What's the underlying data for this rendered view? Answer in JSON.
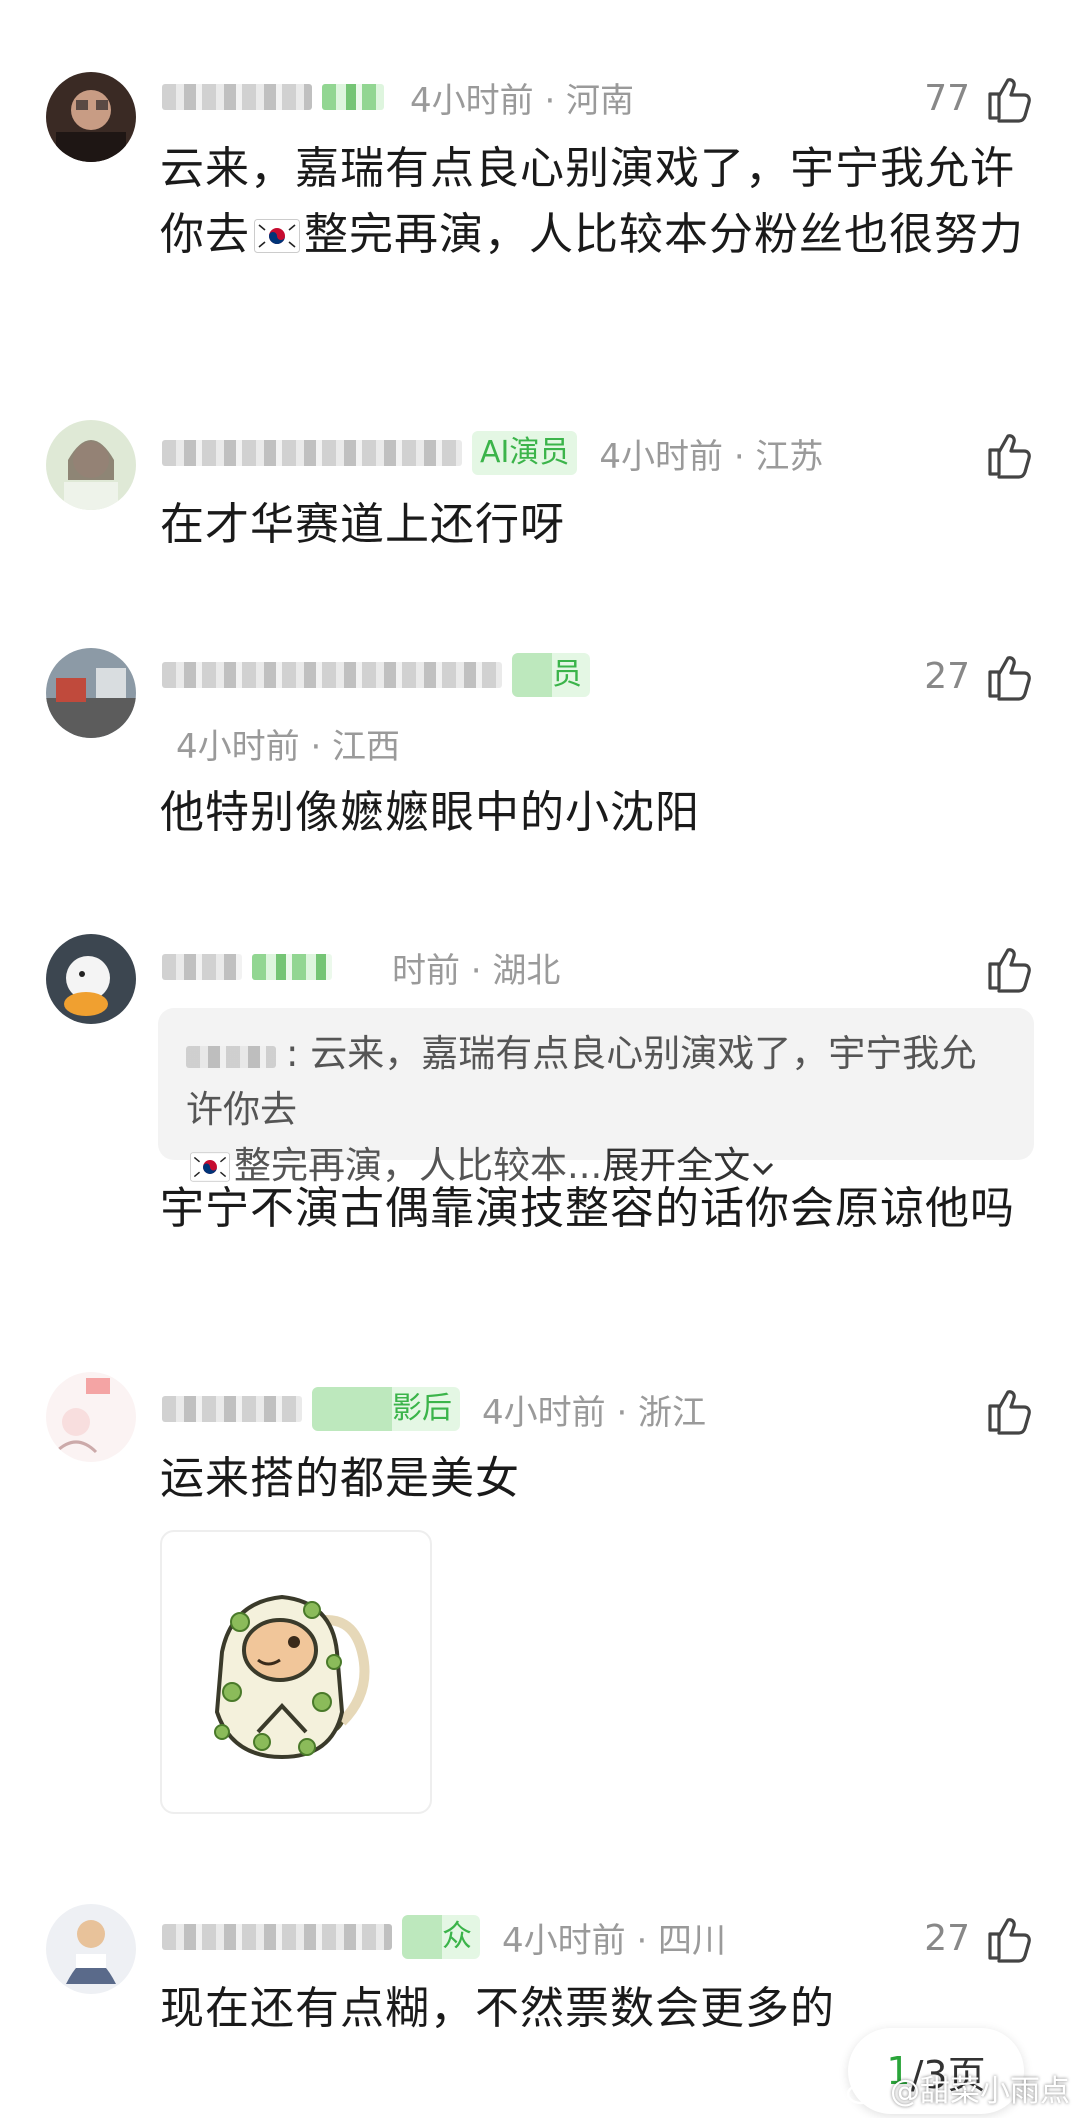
{
  "comments": [
    {
      "badge": "",
      "meta": "4小时前 · 河南",
      "likes": "77",
      "text_a": "云来，嘉瑞有点良心别演戏了，宇宁我允许你去",
      "text_b": "整完再演，人比较本分粉丝也很努力"
    },
    {
      "badge": "AI演员",
      "meta": "4小时前 · 江苏",
      "likes": "",
      "text": "在才华赛道上还行呀"
    },
    {
      "badge": "员",
      "meta": "4小时前 · 江西",
      "likes": "27",
      "text": "他特别像嬷嬷眼中的小沈阳"
    },
    {
      "badge": "",
      "meta": "时前 · 湖北",
      "likes": "",
      "quote_a": ": 云来，嘉瑞有点良心别演戏了，宇宁我允许你去",
      "quote_b": "整完再演，人比较本...",
      "quote_expand": "展开全文",
      "text": "宇宁不演古偶靠演技整容的话你会原谅他吗"
    },
    {
      "badge": "影后",
      "meta": "4小时前 · 浙江",
      "likes": "",
      "text": "运来搭的都是美女"
    },
    {
      "badge": "众",
      "meta": "4小时前 · 四川",
      "likes": "27",
      "text": "现在还有点糊，不然票数会更多的"
    }
  ],
  "pagination": {
    "current": "1",
    "rest": "/3页"
  },
  "watermark": "@甜菜小雨点",
  "icons": {
    "like": "thumbs-up-icon",
    "flag": "south-korea-flag-icon",
    "expand": "chevron-down-icon",
    "watermark": "weibo-icon"
  },
  "colors": {
    "badge_text": "#3bb44a",
    "badge_bg": "#e4f7e4",
    "meta": "#9a9a9a",
    "quote_bg": "#f3f3f3"
  }
}
